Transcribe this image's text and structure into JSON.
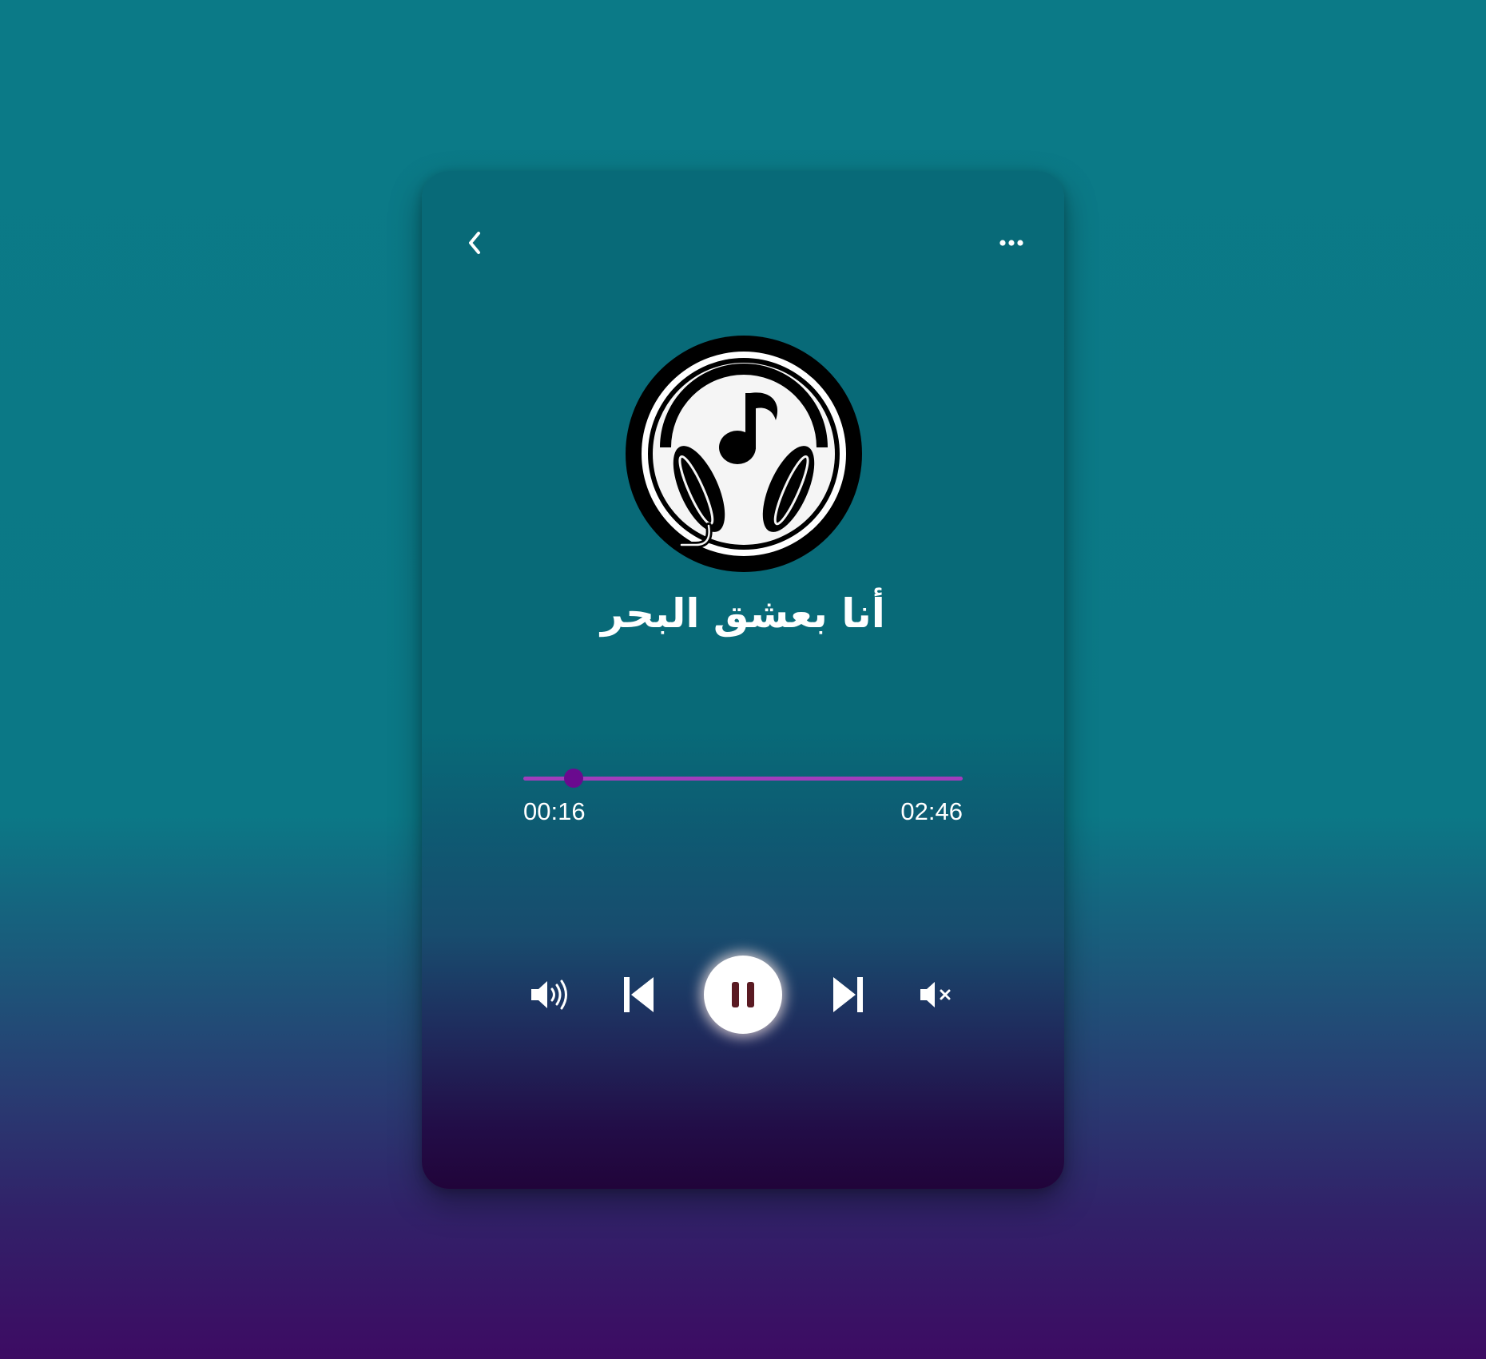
{
  "track": {
    "title": "أنا بعشق البحر",
    "current_time": "00:16",
    "total_time": "02:46",
    "progress_fraction": 0.114
  },
  "colors": {
    "progress_track": "#a23dbc",
    "progress_thumb": "#6a0a8f",
    "pause_bars": "#5a1a22",
    "card_top": "#086a78",
    "card_bottom": "#21043a"
  },
  "icons": {
    "back": "chevron-left-icon",
    "more": "more-horizontal-icon",
    "cover": "headphones-music-note-icon",
    "volume_up": "volume-up-icon",
    "previous": "skip-previous-icon",
    "pause": "pause-icon",
    "next": "skip-next-icon",
    "mute": "volume-mute-icon"
  }
}
